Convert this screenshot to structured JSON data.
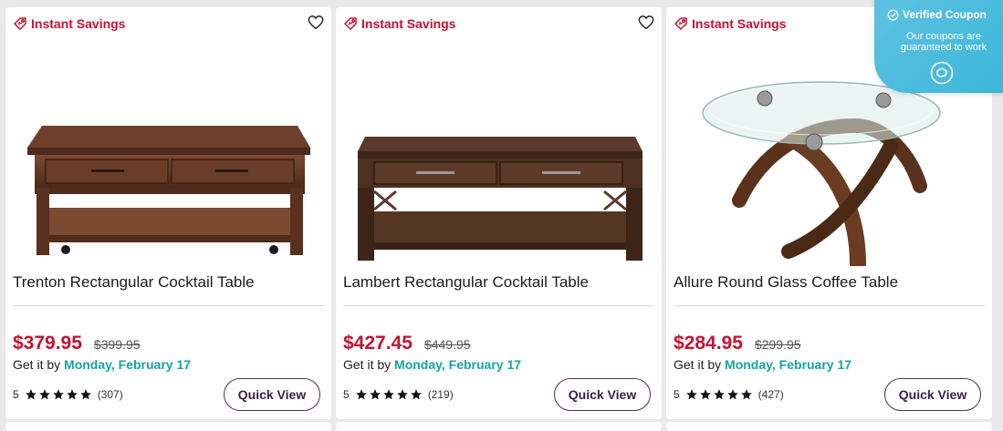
{
  "products": [
    {
      "badge": "Instant Savings",
      "title": "Trenton Rectangular Cocktail Table",
      "price": "$379.95",
      "was_price": "$399.95",
      "delivery_prefix": "Get it by",
      "delivery_date": "Monday, February 17",
      "rating": "5",
      "reviews": "(307)",
      "quick_view": "Quick View"
    },
    {
      "badge": "Instant Savings",
      "title": "Lambert Rectangular Cocktail Table",
      "price": "$427.45",
      "was_price": "$449.95",
      "delivery_prefix": "Get it by",
      "delivery_date": "Monday, February 17",
      "rating": "5",
      "reviews": "(219)",
      "quick_view": "Quick View"
    },
    {
      "badge": "Instant Savings",
      "title": "Allure Round Glass Coffee Table",
      "price": "$284.95",
      "was_price": "$299.95",
      "delivery_prefix": "Get it by",
      "delivery_date": "Monday, February 17",
      "rating": "5",
      "reviews": "(427)",
      "quick_view": "Quick View"
    }
  ],
  "coupon": {
    "title": "Verified Coupon",
    "text": "Our coupons are guaranteed to work"
  },
  "colors": {
    "sale_red": "#c4122f",
    "delivery_teal": "#15a3a3",
    "button_border": "#522d5b",
    "coupon_blue": "#4bbde0"
  }
}
